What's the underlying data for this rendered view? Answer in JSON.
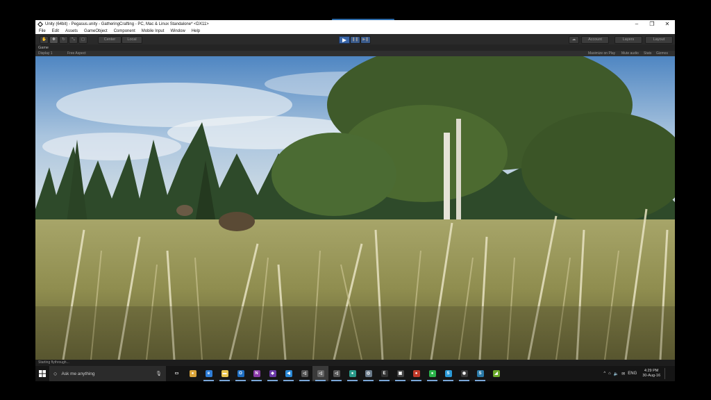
{
  "window": {
    "title": "Unity (64bit) - Pegasus.unity - GatheringCrafting - PC, Mac & Linux Standalone* <DX11>",
    "controls": [
      "–",
      "❐",
      "✕"
    ]
  },
  "menu": [
    "File",
    "Edit",
    "Assets",
    "GameObject",
    "Component",
    "Mobile Input",
    "Window",
    "Help"
  ],
  "toolbar": {
    "center_label": "Center",
    "local_label": "Local",
    "account_label": "Account",
    "layers_label": "Layers",
    "layout_label": "Layout"
  },
  "game_tab": {
    "label": "Game",
    "display": "Display 1",
    "aspect": "Free Aspect",
    "maximize": "Maximize on Play",
    "mute": "Mute audio",
    "stats": "Stats",
    "gizmos": "Gizmos"
  },
  "status": "Starting flythrough...",
  "taskbar": {
    "search_placeholder": "Ask me anything",
    "apps": [
      {
        "name": "task-view",
        "glyph": "▭",
        "color": "#151515"
      },
      {
        "name": "chrome",
        "glyph": "●",
        "color": "#d9a43a"
      },
      {
        "name": "edge",
        "glyph": "e",
        "color": "#2f7ed8"
      },
      {
        "name": "file-explorer",
        "glyph": "▬",
        "color": "#e8c44f"
      },
      {
        "name": "outlook",
        "glyph": "O",
        "color": "#1f6fc2"
      },
      {
        "name": "onenote",
        "glyph": "N",
        "color": "#8a3aa8"
      },
      {
        "name": "visual-studio",
        "glyph": "◆",
        "color": "#6b3aa8"
      },
      {
        "name": "vscode",
        "glyph": "◀",
        "color": "#2a8ad8"
      },
      {
        "name": "unity",
        "glyph": "◁",
        "color": "#555555"
      },
      {
        "name": "unity-active",
        "glyph": "◁",
        "color": "#666666"
      },
      {
        "name": "unity-2",
        "glyph": "◁",
        "color": "#555555"
      },
      {
        "name": "app-teal",
        "glyph": "●",
        "color": "#2a9a8a"
      },
      {
        "name": "app-globe",
        "glyph": "◎",
        "color": "#6a7a8a"
      },
      {
        "name": "epic-games",
        "glyph": "E",
        "color": "#333333"
      },
      {
        "name": "store",
        "glyph": "▣",
        "color": "#444444"
      },
      {
        "name": "app-red",
        "glyph": "●",
        "color": "#c23a2a"
      },
      {
        "name": "spotify",
        "glyph": "●",
        "color": "#2bb34a"
      },
      {
        "name": "skype",
        "glyph": "S",
        "color": "#2a9ad8"
      },
      {
        "name": "steam",
        "glyph": "◉",
        "color": "#3a3a3a"
      },
      {
        "name": "app-s",
        "glyph": "S",
        "color": "#2a7aa8"
      },
      {
        "name": "nvidia",
        "glyph": "◢",
        "color": "#6aa82a"
      }
    ],
    "tray": [
      "^",
      "⌂",
      "🔈",
      "✉",
      "ENG"
    ],
    "time": "4:29 PM",
    "date": "30-Aug-16"
  }
}
